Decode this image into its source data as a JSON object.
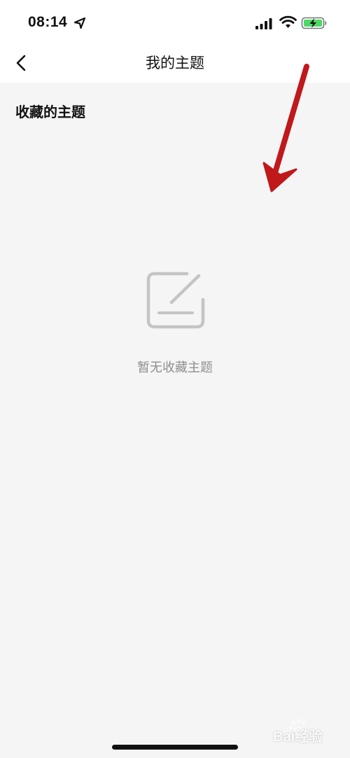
{
  "status_bar": {
    "time": "08:14",
    "location_icon": "location-arrow-icon",
    "signal_icon": "cellular-signal-icon",
    "wifi_icon": "wifi-icon",
    "battery_icon": "battery-charging-icon"
  },
  "nav": {
    "back_icon": "chevron-left-icon",
    "title": "我的主题"
  },
  "section": {
    "title": "收藏的主题"
  },
  "empty_state": {
    "icon": "edit-note-icon",
    "text": "暂无收藏主题"
  },
  "watermark": {
    "text": "Bai经验"
  },
  "colors": {
    "background": "#f5f5f5",
    "header_background": "#ffffff",
    "text_primary": "#111111",
    "text_secondary": "#8e8e8e",
    "battery_green": "#4cd964",
    "annotation_red": "#c0191b"
  }
}
